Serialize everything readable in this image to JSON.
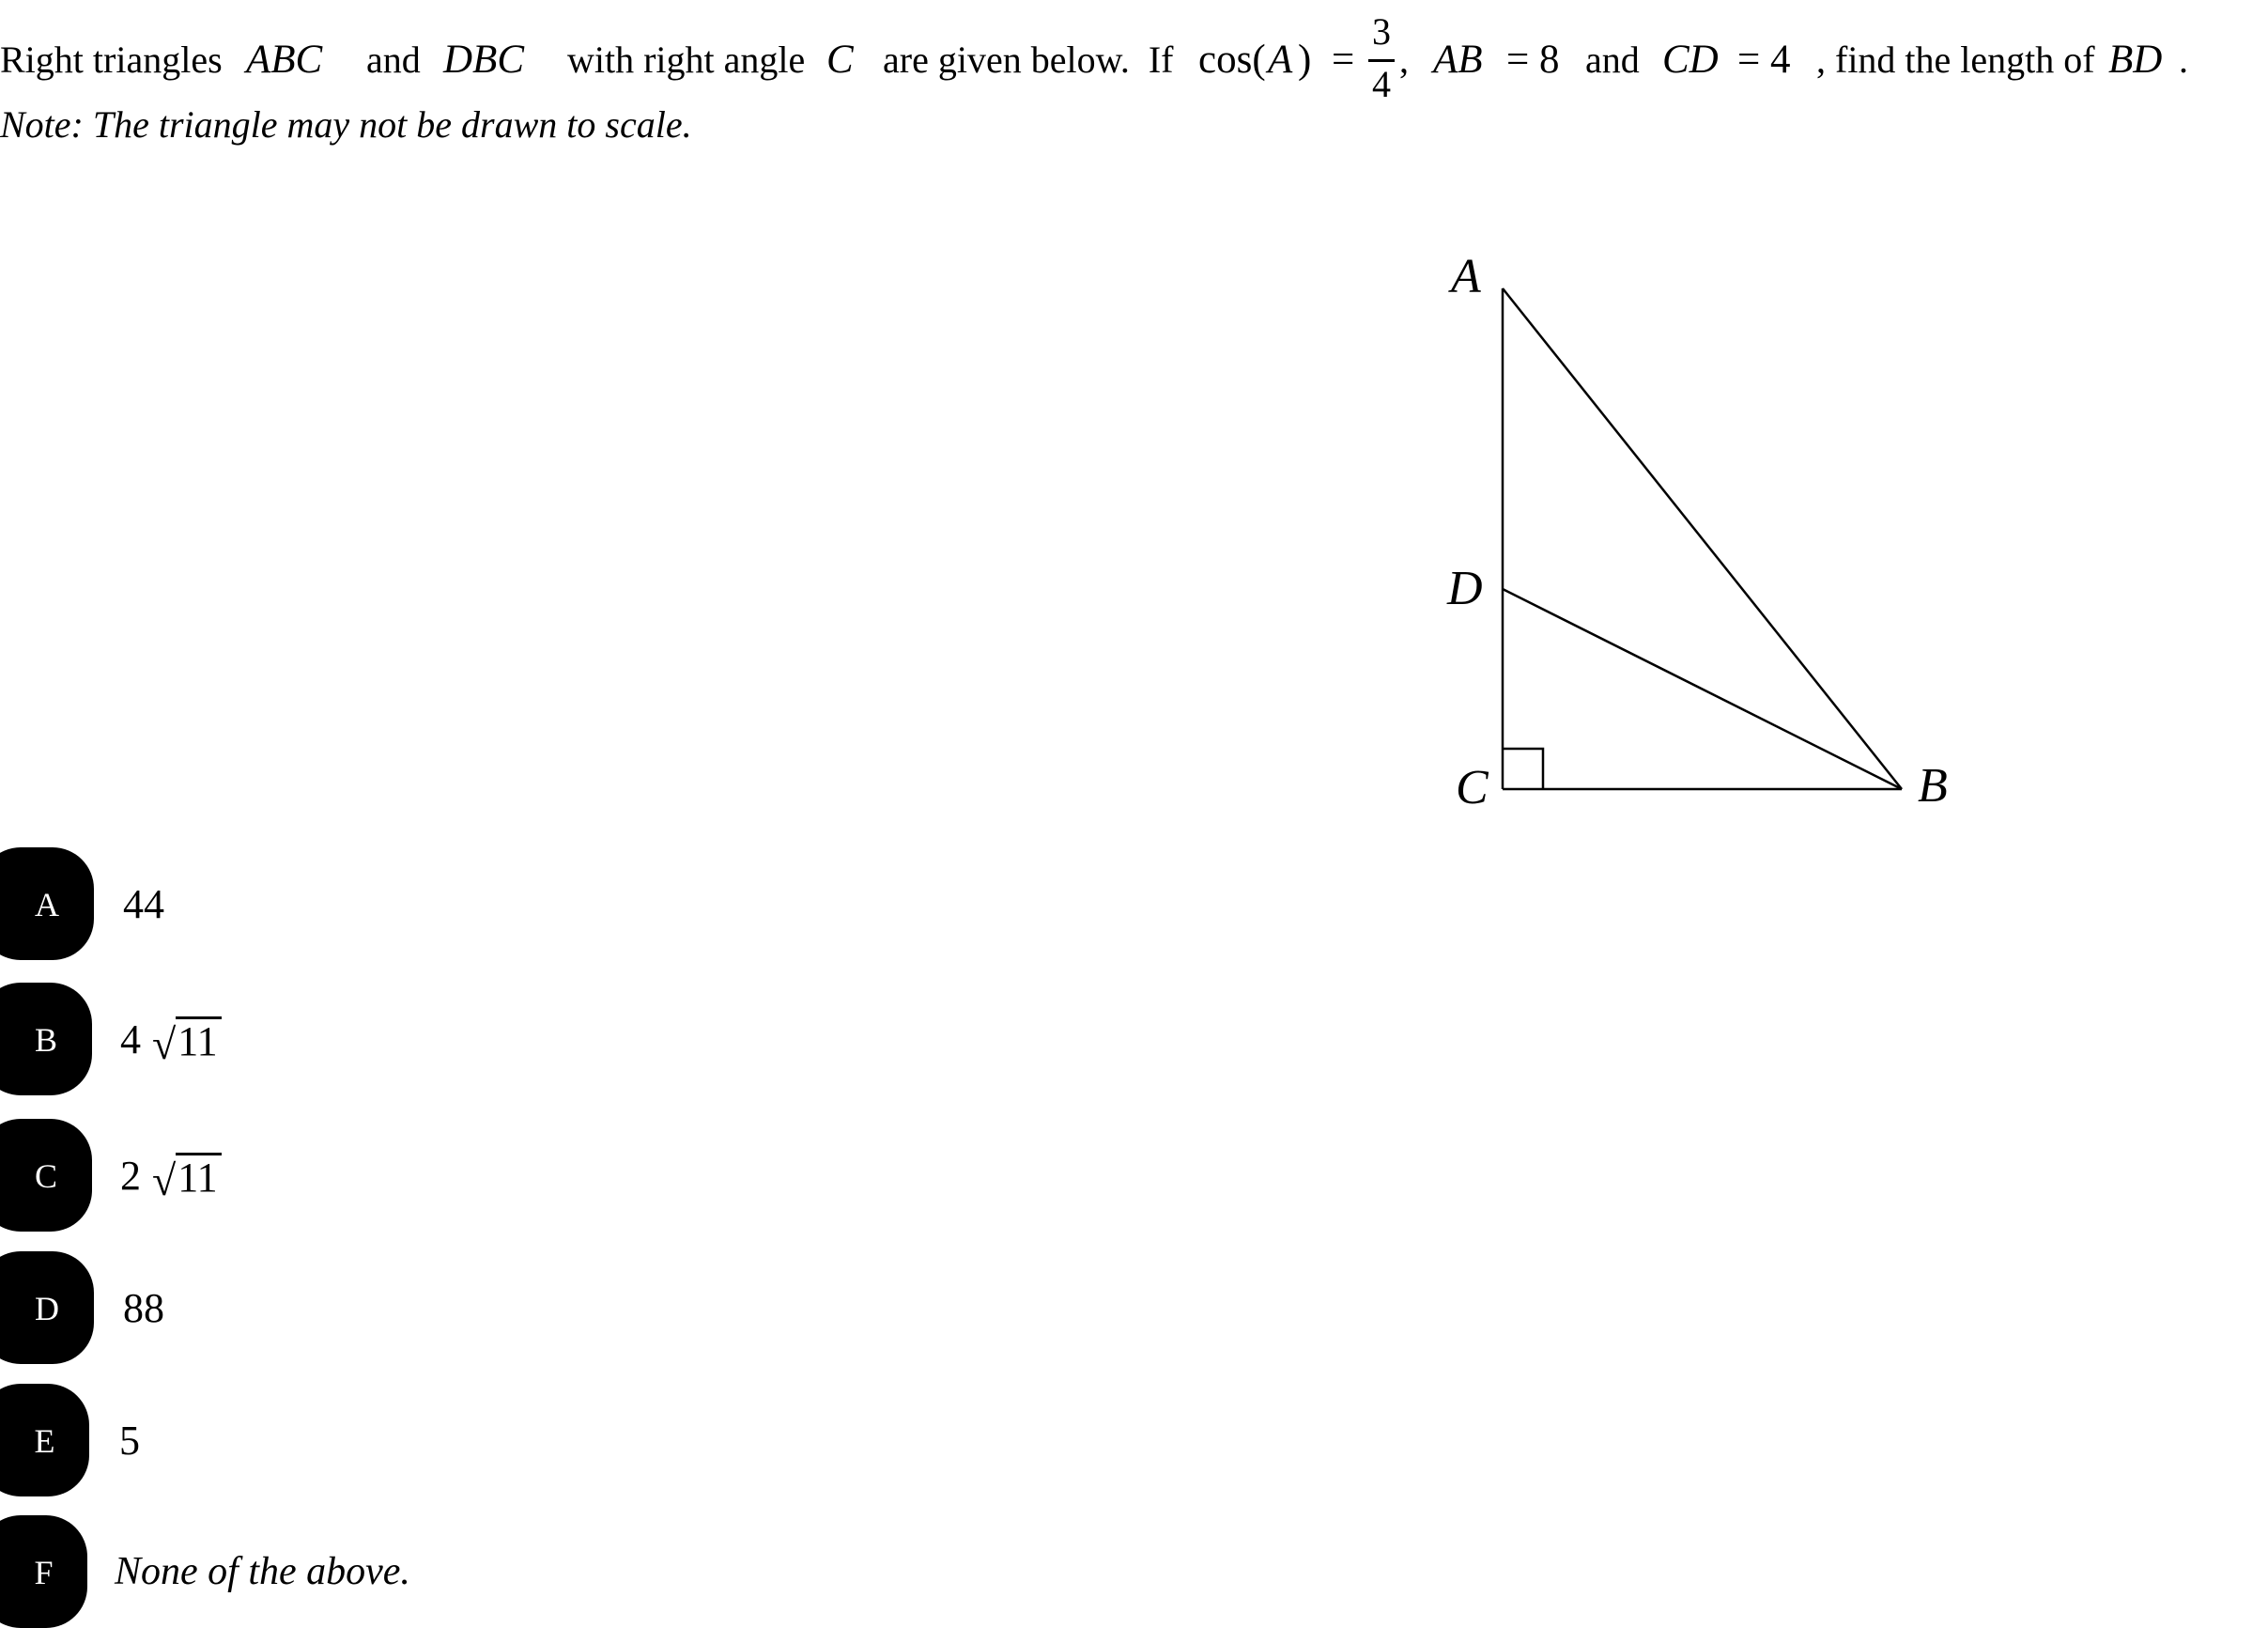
{
  "question": {
    "segments": [
      {
        "text": "Right triangles",
        "style": "text"
      },
      {
        "text": "ABC",
        "style": "math"
      },
      {
        "text": "and",
        "style": "text"
      },
      {
        "text": "DBC",
        "style": "math"
      },
      {
        "text": "with right angle",
        "style": "text"
      },
      {
        "text": "C",
        "style": "math"
      },
      {
        "text": "are given below.  If",
        "style": "text"
      },
      {
        "text": "cos(",
        "style": "math-roman"
      },
      {
        "text": "A",
        "style": "math"
      },
      {
        "text": ")",
        "style": "math-roman"
      },
      {
        "text": "=",
        "style": "math-roman"
      },
      {
        "text": ",",
        "style": "text"
      },
      {
        "text": "AB",
        "style": "math"
      },
      {
        "text": "= 8",
        "style": "math-roman"
      },
      {
        "text": "and",
        "style": "text"
      },
      {
        "text": "CD",
        "style": "math"
      },
      {
        "text": "= 4",
        "style": "math-roman"
      },
      {
        "text": ", find the length of",
        "style": "text"
      },
      {
        "text": "BD",
        "style": "math"
      },
      {
        "text": ".",
        "style": "text"
      }
    ],
    "fraction": {
      "numerator": "3",
      "denominator": "4"
    },
    "note": "Note: The triangle may not be drawn to scale."
  },
  "figure": {
    "vertices": {
      "A": "A",
      "B": "B",
      "C": "C",
      "D": "D"
    },
    "right_angle_at": "C",
    "segments": [
      "AC",
      "CB",
      "AB",
      "DB"
    ]
  },
  "options": [
    {
      "letter": "A",
      "value": "44",
      "type": "plain"
    },
    {
      "letter": "B",
      "coefficient": "4",
      "radicand": "11",
      "type": "sqrt"
    },
    {
      "letter": "C",
      "coefficient": "2",
      "radicand": "11",
      "type": "sqrt"
    },
    {
      "letter": "D",
      "value": "88",
      "type": "plain"
    },
    {
      "letter": "E",
      "value": "5",
      "type": "plain"
    },
    {
      "letter": "F",
      "value": "None of the above.",
      "type": "italic"
    }
  ],
  "colors": {
    "badge_bg": "#000000",
    "badge_text": "#ffffff",
    "text": "#000000",
    "background": "#ffffff"
  }
}
